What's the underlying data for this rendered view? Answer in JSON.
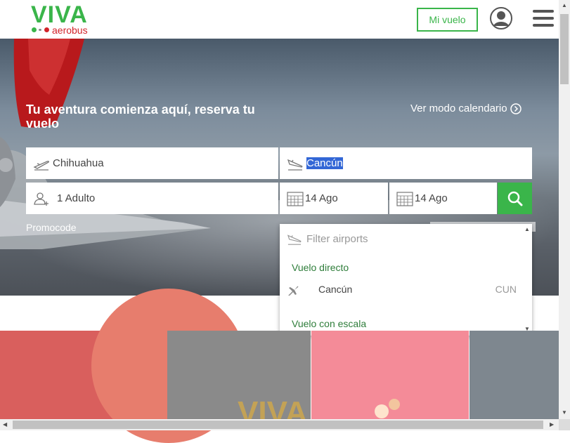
{
  "header": {
    "logo_main": "VIVA",
    "logo_sub": "aerobus",
    "mi_vuelo_label": "Mi vuelo"
  },
  "hero": {
    "title": "Tu aventura comienza aquí, reserva tu vuelo",
    "calendar_link": "Ver modo calendario",
    "promocode_label": "Promocode"
  },
  "search": {
    "origin": "Chihuahua",
    "destination": "Cancún",
    "passengers": "1 Adulto",
    "depart_date": "14 Ago",
    "return_date": "14 Ago"
  },
  "dropdown": {
    "filter_placeholder": "Filter airports",
    "group_direct": "Vuelo directo",
    "items": [
      {
        "name": "Cancún",
        "code": "CUN"
      }
    ],
    "group_stop": "Vuelo con escala"
  },
  "promos": {
    "banner2_text": "VIVA"
  },
  "colors": {
    "brand_green": "#3ab54a",
    "brand_red": "#d2232a",
    "selection_blue": "#3367d6"
  }
}
